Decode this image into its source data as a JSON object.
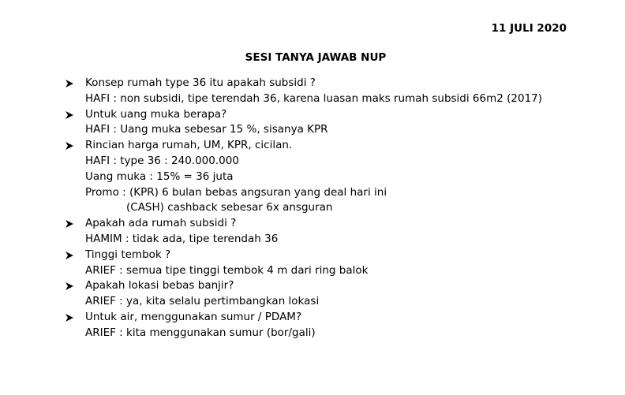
{
  "header": {
    "date": "11 JULI 2020",
    "title": "SESI TANYA JAWAB NUP"
  },
  "qa": [
    {
      "question": "Konsep rumah type 36 itu apakah subsidi ?",
      "answers": [
        "HAFI : non subsidi, tipe terendah 36, karena luasan maks rumah subsidi 66m2 (2017)"
      ]
    },
    {
      "question": "Untuk uang muka berapa?",
      "answers": [
        "HAFI : Uang muka sebesar 15 %, sisanya  KPR"
      ]
    },
    {
      "question": "Rincian harga rumah, UM, KPR, cicilan.",
      "answers": [
        "HAFI : type 36 : 240.000.000",
        "Uang muka : 15% = 36 juta",
        "Promo : (KPR) 6 bulan bebas  angsuran yang deal hari ini",
        "(CASH) cashback sebesar 6x ansguran"
      ]
    },
    {
      "question": "Apakah ada rumah subsidi  ?",
      "answers": [
        "HAMIM : tidak ada, tipe terendah  36"
      ]
    },
    {
      "question": "Tinggi tembok ?",
      "answers": [
        "ARIEF : semua tipe tinggi tembok 4 m dari ring balok"
      ]
    },
    {
      "question": "Apakah lokasi bebas banjir?",
      "answers": [
        "ARIEF : ya, kita selalu pertimbangkan lokasi"
      ]
    },
    {
      "question": "Untuk air, menggunakan sumur / PDAM?",
      "answers": [
        "ARIEF : kita menggunakan sumur (bor/gali)"
      ]
    }
  ],
  "icons": {
    "bullet": "arrowhead-bullet-icon"
  }
}
